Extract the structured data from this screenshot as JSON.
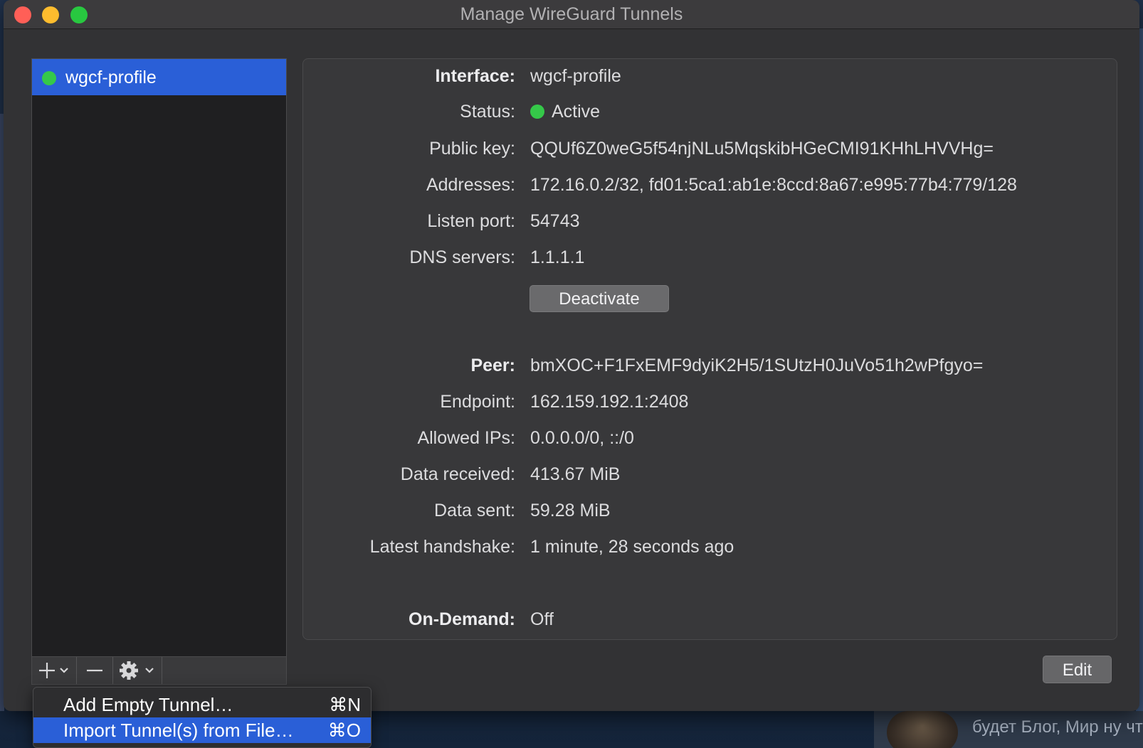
{
  "window": {
    "title": "Manage WireGuard Tunnels"
  },
  "sidebar": {
    "tunnels": [
      {
        "name": "wgcf-profile",
        "status_color": "#35c849",
        "selected": true
      }
    ],
    "toolbar": {
      "add_icon": "plus-icon",
      "remove_icon": "minus-icon",
      "actions_icon": "gear-icon"
    }
  },
  "menu": {
    "items": [
      {
        "label": "Add Empty Tunnel…",
        "shortcut": "⌘N",
        "highlighted": false
      },
      {
        "label": "Import Tunnel(s) from File…",
        "shortcut": "⌘O",
        "highlighted": true
      }
    ]
  },
  "details": {
    "interface": {
      "label": "Interface:",
      "value": "wgcf-profile"
    },
    "status": {
      "label": "Status:",
      "value": "Active",
      "color": "#35c849"
    },
    "public_key": {
      "label": "Public key:",
      "value": "QQUf6Z0weG5f54njNLu5MqskibHGeCMI91KHhLHVVHg="
    },
    "addresses": {
      "label": "Addresses:",
      "value": "172.16.0.2/32, fd01:5ca1:ab1e:8ccd:8a67:e995:77b4:779/128"
    },
    "listen_port": {
      "label": "Listen port:",
      "value": "54743"
    },
    "dns_servers": {
      "label": "DNS servers:",
      "value": "1.1.1.1"
    },
    "deactivate_label": "Deactivate",
    "peer": {
      "label": "Peer:",
      "value": "bmXOC+F1FxEMF9dyiK2H5/1SUtzH0JuVo51h2wPfgyo="
    },
    "endpoint": {
      "label": "Endpoint:",
      "value": "162.159.192.1:2408"
    },
    "allowed_ips": {
      "label": "Allowed IPs:",
      "value": "0.0.0.0/0, ::/0"
    },
    "data_received": {
      "label": "Data received:",
      "value": "413.67 MiB"
    },
    "data_sent": {
      "label": "Data sent:",
      "value": "59.28 MiB"
    },
    "latest_handshake": {
      "label": "Latest handshake:",
      "value": "1 minute, 28 seconds ago"
    },
    "on_demand": {
      "label": "On-Demand:",
      "value": "Off"
    }
  },
  "edit_label": "Edit",
  "background_notification": {
    "text": "будет Блог, Мир ну что добавим"
  }
}
